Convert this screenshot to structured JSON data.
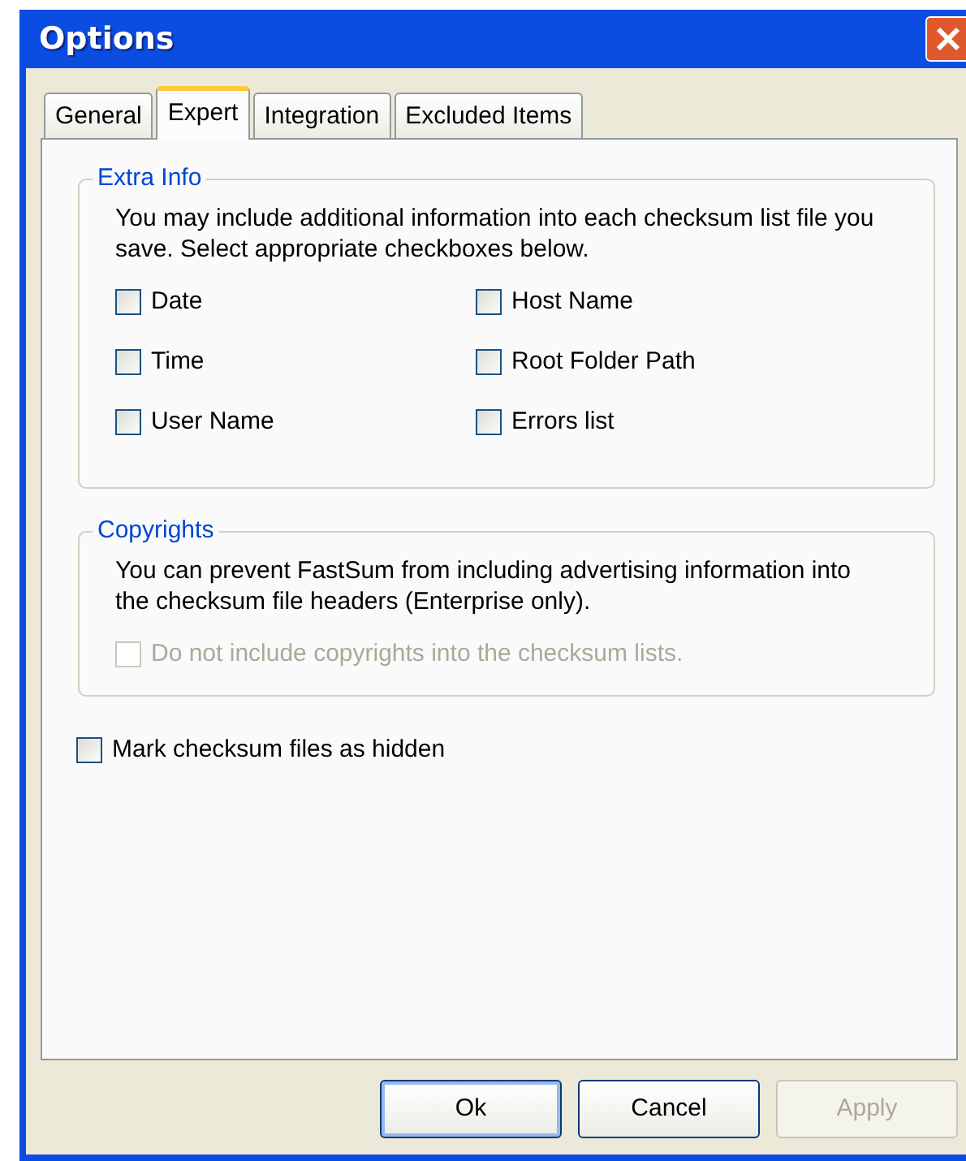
{
  "window": {
    "title": "Options"
  },
  "tabs": [
    {
      "label": "General",
      "selected": false
    },
    {
      "label": "Expert",
      "selected": true
    },
    {
      "label": "Integration",
      "selected": false
    },
    {
      "label": "Excluded Items",
      "selected": false
    }
  ],
  "groups": [
    {
      "title": "Extra Info",
      "description": "You may include additional information into each checksum list file you save. Select appropriate checkboxes below.",
      "options": [
        {
          "label": "Date",
          "checked": false,
          "disabled": false
        },
        {
          "label": "Time",
          "checked": false,
          "disabled": false
        },
        {
          "label": "User Name",
          "checked": false,
          "disabled": false
        },
        {
          "label": "Host Name",
          "checked": false,
          "disabled": false
        },
        {
          "label": "Root Folder Path",
          "checked": false,
          "disabled": false
        },
        {
          "label": "Errors list",
          "checked": false,
          "disabled": false
        }
      ]
    },
    {
      "title": "Copyrights",
      "description": "You can prevent FastSum from including advertising information into the checksum file headers (Enterprise only).",
      "options": [
        {
          "label": "Do not include copyrights into the checksum lists.",
          "checked": false,
          "disabled": true
        }
      ]
    }
  ],
  "options": [
    {
      "label": "Mark checksum files as hidden",
      "checked": false,
      "disabled": false
    }
  ],
  "buttons": [
    {
      "label": "Ok",
      "default": true,
      "disabled": false
    },
    {
      "label": "Cancel",
      "default": false,
      "disabled": false
    },
    {
      "label": "Apply",
      "default": false,
      "disabled": true
    }
  ]
}
